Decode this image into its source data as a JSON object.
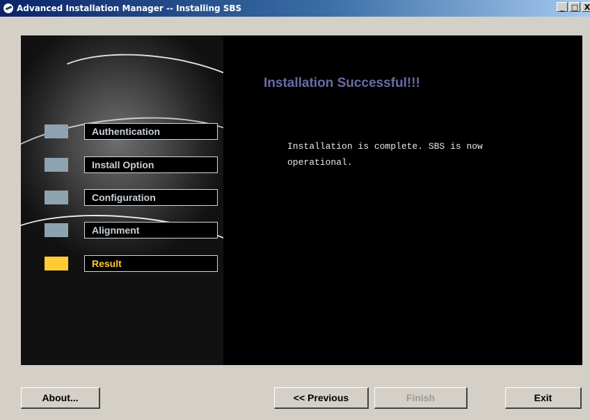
{
  "window": {
    "title": "Advanced Installation Manager -- Installing SBS",
    "buttons": {
      "minimize": "_",
      "maximize": "□",
      "close": "X"
    }
  },
  "steps": [
    {
      "label": "Authentication",
      "active": false
    },
    {
      "label": "Install Option",
      "active": false
    },
    {
      "label": "Configuration",
      "active": false
    },
    {
      "label": "Alignment",
      "active": false
    },
    {
      "label": "Result",
      "active": true
    }
  ],
  "content": {
    "heading": "Installation Successful!!!",
    "message": "Installation is complete. SBS is now\noperational."
  },
  "footer": {
    "about_label": "About...",
    "previous_label": "<< Previous",
    "finish_label": "Finish",
    "exit_label": "Exit"
  },
  "colors": {
    "heading": "#6a6aa8",
    "active_step": "#ffcc33",
    "inactive_step": "#8ea3b0"
  }
}
